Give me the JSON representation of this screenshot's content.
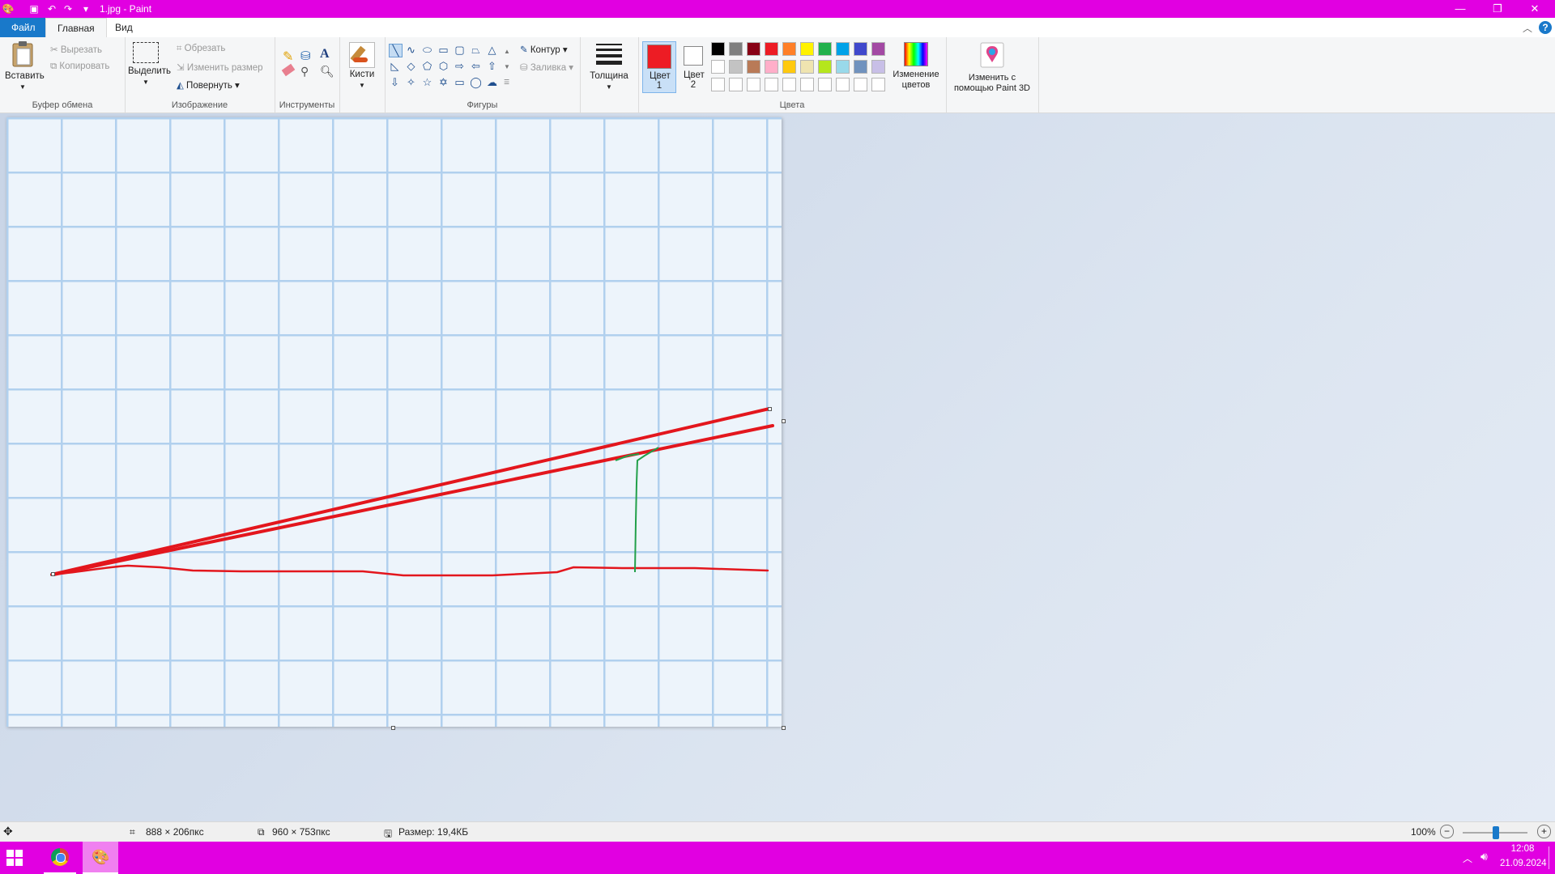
{
  "window": {
    "title": "1.jpg - Paint",
    "controls": [
      "minimize",
      "restore",
      "close"
    ]
  },
  "menu": {
    "file": "Файл",
    "home": "Главная",
    "view": "Вид"
  },
  "ribbon": {
    "clipboard": {
      "paste": "Вставить",
      "cut": "Вырезать",
      "copy": "Копировать",
      "label": "Буфер обмена"
    },
    "image": {
      "select": "Выделить",
      "crop": "Обрезать",
      "resize": "Изменить размер",
      "rotate": "Повернуть",
      "label": "Изображение"
    },
    "tools": {
      "label": "Инструменты"
    },
    "brushes": {
      "label": "Кисти"
    },
    "shapes": {
      "outline": "Контур",
      "fill": "Заливка",
      "label": "Фигуры"
    },
    "size": {
      "label": "Толщина"
    },
    "colors": {
      "color1": "Цвет 1",
      "color2": "Цвет 2",
      "edit": "Изменение цветов",
      "label": "Цвета",
      "color1_value": "#ed1c24",
      "color2_value": "#ffffff",
      "palette_row1": [
        "#000000",
        "#7f7f7f",
        "#880015",
        "#ed1c24",
        "#ff7f27",
        "#fff200",
        "#22b14c",
        "#00a2e8",
        "#3f48cc",
        "#a349a4"
      ],
      "palette_row2": [
        "#ffffff",
        "#c3c3c3",
        "#b97a57",
        "#ffaec9",
        "#ffc90e",
        "#efe4b0",
        "#b5e61d",
        "#99d9ea",
        "#7092be",
        "#c8bfe7"
      ]
    },
    "paint3d": {
      "label": "Изменить с помощью Paint 3D"
    }
  },
  "status": {
    "cursor": "888 × 206пкс",
    "dims": "960 × 753пкс",
    "size": "Размер: 19,4КБ",
    "zoom": "100%"
  },
  "taskbar": {
    "time": "12:08",
    "date": "21.09.2024"
  }
}
